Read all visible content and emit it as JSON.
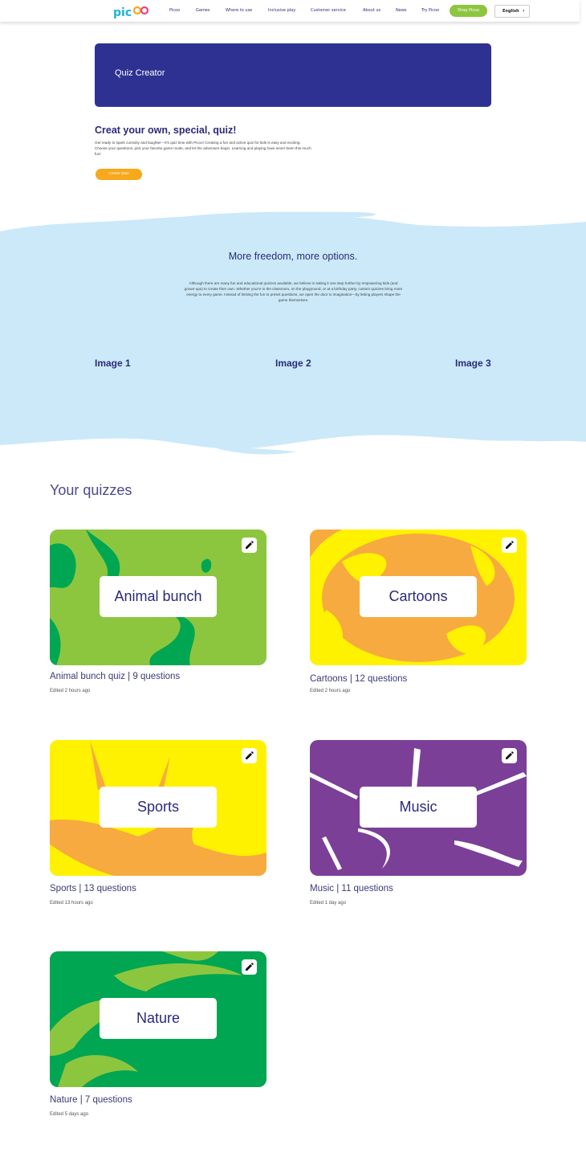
{
  "nav": {
    "logo": "pic",
    "links": [
      "Picoo",
      "Games",
      "Where to use",
      "Inclusive play",
      "Customer service",
      "About us",
      "News",
      "Try Picoo"
    ],
    "shop_label": "Shop Picoo",
    "language": "English"
  },
  "hero": {
    "title": "Quiz Creator"
  },
  "intro": {
    "heading": "Creat your own, special, quiz!",
    "body": "Get ready to spark curiosity and laughter—it's quiz time with Picoo! Creating a fun and active quiz for kids is easy and exciting. Choose your questions, pick your favorite game mode, and let the adventure begin. Learning and playing have never been this much fun!",
    "create_label": "Create Quiz"
  },
  "band": {
    "heading": "More freedom, more options.",
    "body": "Although there are many fun and educational quizzes available, we believe in taking it one step further by empowering kids (and grown-ups) to create their own. Whether you're in the classroom, on the playground, or at a birthday party, custom quizzes bring more energy to every game. Instead of limiting the fun to preset questions, we open the door to imagination—by letting players shape the game themselves.",
    "images": [
      "Image 1",
      "Image 2",
      "Image 3"
    ]
  },
  "quizzes": {
    "title": "Your quizzes",
    "items": [
      {
        "name": "Animal bunch",
        "meta": "Animal bunch quiz | 9 questions",
        "edited": "Edited 2 hours ago"
      },
      {
        "name": "Cartoons",
        "meta": "Cartoons | 12 questions",
        "edited": "Edited 2 hours ago"
      },
      {
        "name": "Sports",
        "meta": "Sports | 13 questions",
        "edited": "Edited 13 hours ago"
      },
      {
        "name": "Music",
        "meta": "Music | 11 questions",
        "edited": "Edited 1 day ago"
      },
      {
        "name": "Nature",
        "meta": "Nature | 7 questions",
        "edited": "Edited 5 days ago"
      }
    ]
  },
  "colors": {
    "navy": "#2e3192",
    "text": "#2b2a7a",
    "green_button": "#8cc63f",
    "orange_button": "#f7a81b",
    "band_blue": "#cbe9f8",
    "card_green": "#8cc63f",
    "card_yellow": "#fff200",
    "card_purple": "#7b3f98",
    "card_darkgreen": "#00a651"
  }
}
